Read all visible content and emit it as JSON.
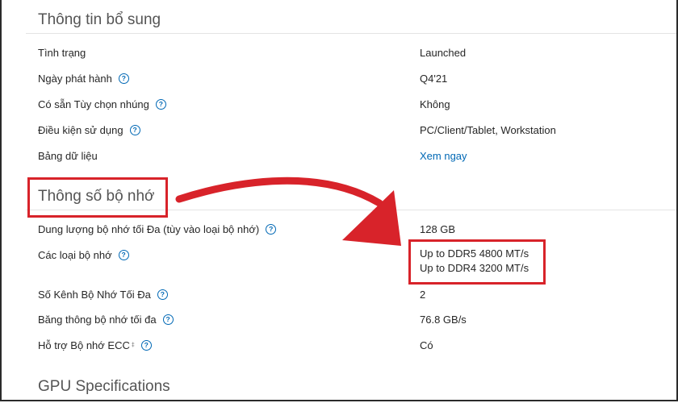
{
  "sections": {
    "additional_info": {
      "title": "Thông tin bổ sung",
      "rows": [
        {
          "label": "Tình trạng",
          "value": "Launched",
          "help": false
        },
        {
          "label": "Ngày phát hành",
          "value": "Q4'21",
          "help": true
        },
        {
          "label": "Có sẵn Tùy chọn nhúng",
          "value": "Không",
          "help": true
        },
        {
          "label": "Điều kiện sử dụng",
          "value": "PC/Client/Tablet, Workstation",
          "help": true
        },
        {
          "label": "Bảng dữ liệu",
          "value": "Xem ngay",
          "help": false,
          "link": true
        }
      ]
    },
    "memory_specs": {
      "title": "Thông số bộ nhớ",
      "rows": [
        {
          "label": "Dung lượng bộ nhớ tối Đa (tùy vào loại bộ nhớ)",
          "value": "128 GB",
          "help": true
        },
        {
          "label": "Các loại bộ nhớ",
          "value_line1": "Up to DDR5 4800 MT/s",
          "value_line2": "Up to DDR4 3200 MT/s",
          "help": true
        },
        {
          "label": "Số Kênh Bộ Nhớ Tối Đa",
          "value": "2",
          "help": true
        },
        {
          "label": "Băng thông bộ nhớ tối đa",
          "value": "76.8 GB/s",
          "help": true
        },
        {
          "label": "Hỗ trợ Bộ nhớ ECC",
          "label_mark": "‡",
          "value": "Có",
          "help": true
        }
      ]
    },
    "gpu_specs": {
      "title": "GPU Specifications"
    }
  },
  "help_glyph": "?",
  "icons": {
    "help": "question-circle-icon"
  },
  "colors": {
    "highlight": "#d8232a",
    "link": "#0068b5",
    "text": "#262626",
    "title": "#555555"
  }
}
